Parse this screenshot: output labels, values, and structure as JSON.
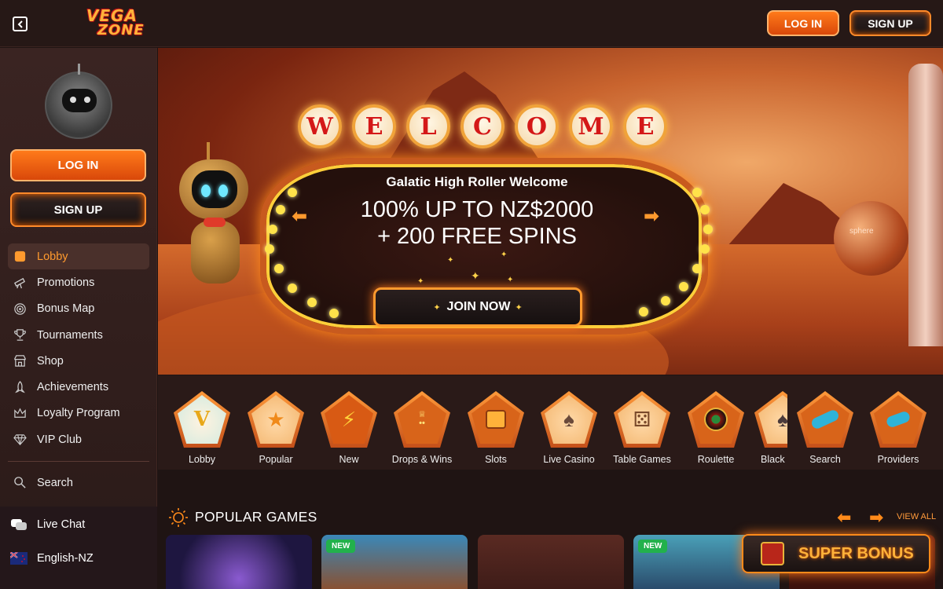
{
  "header": {
    "logo_line1": "VEGA",
    "logo_line2": "ZONE",
    "login_label": "LOG IN",
    "signup_label": "SIGN UP"
  },
  "sidebar": {
    "login_label": "LOG IN",
    "signup_label": "SIGN UP",
    "items": [
      {
        "label": "Lobby",
        "icon": "lobby-icon",
        "active": true
      },
      {
        "label": "Promotions",
        "icon": "telescope-icon",
        "active": false
      },
      {
        "label": "Bonus Map",
        "icon": "spiral-map-icon",
        "active": false
      },
      {
        "label": "Tournaments",
        "icon": "trophy-icon",
        "active": false
      },
      {
        "label": "Shop",
        "icon": "shop-icon",
        "active": false
      },
      {
        "label": "Achievements",
        "icon": "rocket-icon",
        "active": false
      },
      {
        "label": "Loyalty Program",
        "icon": "crown-icon",
        "active": false
      },
      {
        "label": "VIP Club",
        "icon": "diamond-icon",
        "active": false
      }
    ],
    "search_label": "Search",
    "live_chat_label": "Live Chat",
    "language_label": "English-NZ"
  },
  "banner": {
    "welcome_letters": [
      "W",
      "E",
      "L",
      "C",
      "O",
      "M",
      "E"
    ],
    "subtitle": "Galatic High Roller Welcome",
    "offer_line1": "100% UP TO NZ$2000",
    "offer_line2": "+ 200 FREE SPINS",
    "cta_label": "JOIN NOW",
    "sphere_label": "sphere"
  },
  "categories": [
    {
      "label": "Lobby",
      "icon": "v-logo-icon"
    },
    {
      "label": "Popular",
      "icon": "star-cards-icon"
    },
    {
      "label": "New",
      "icon": "lightning-icon"
    },
    {
      "label": "Drops & Wins",
      "icon": "drops-wins-icon"
    },
    {
      "label": "Slots",
      "icon": "slot-machine-icon"
    },
    {
      "label": "Live Casino",
      "icon": "live-casino-icon"
    },
    {
      "label": "Table Games",
      "icon": "dice-icon"
    },
    {
      "label": "Roulette",
      "icon": "roulette-icon"
    },
    {
      "label": "Black",
      "icon": "cards-icon"
    },
    {
      "label": "Search",
      "icon": "telescope-icon"
    },
    {
      "label": "Providers",
      "icon": "providers-icon"
    }
  ],
  "popular": {
    "title": "POPULAR GAMES",
    "view_all_label": "VIEW ALL",
    "games": [
      {
        "badge": ""
      },
      {
        "badge": "NEW"
      },
      {
        "badge": ""
      },
      {
        "badge": "NEW"
      },
      {
        "badge": ""
      }
    ]
  },
  "super_bonus": {
    "label": "SUPER BONUS"
  },
  "colors": {
    "accent": "#ff8a1a",
    "background": "#1f1413",
    "sidebar": "#2e1d1b",
    "new_badge": "#22b14c"
  }
}
